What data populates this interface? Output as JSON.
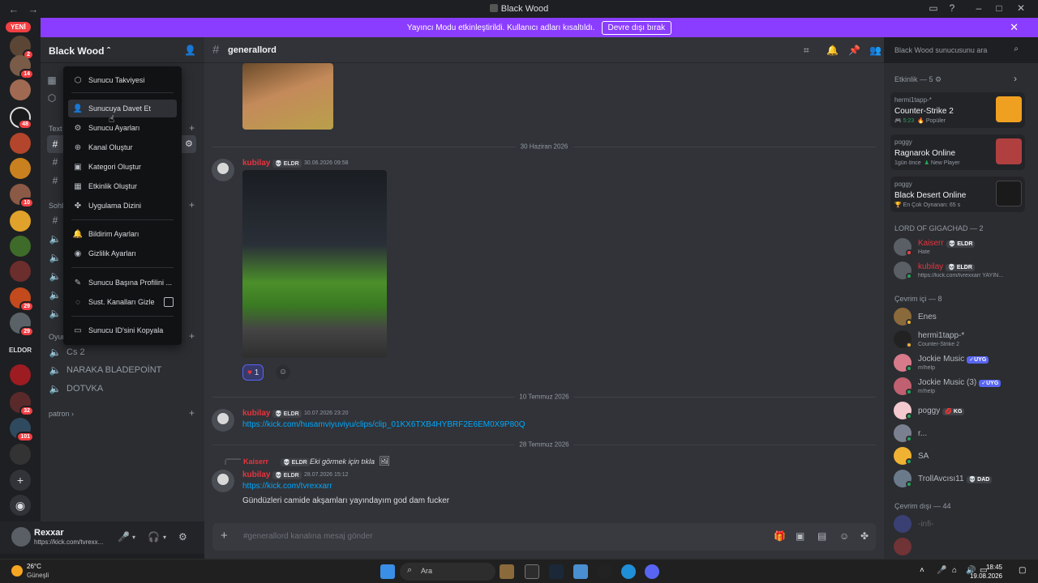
{
  "window": {
    "title": "Black Wood",
    "back_icon": "←",
    "forward_icon": "→"
  },
  "banner": {
    "text": "Yayıncı Modu etkinleştirildi. Kullanıcı adları kısaltıldı.",
    "button": "Devre dışı bırak"
  },
  "rail": {
    "yeni": "YENİ",
    "badges": [
      "2",
      "14",
      "48",
      "10",
      "29",
      "29",
      "32",
      "101"
    ],
    "eldor": "ELDOR"
  },
  "sidebar": {
    "server_name": "Black Wood",
    "categories": [
      "Text",
      "Sohb",
      "Oyun",
      "patron"
    ],
    "channels": [
      "Cs 2",
      "NARAKA BLADEPOİNT",
      "DOTVKA"
    ]
  },
  "menu": {
    "items": [
      "Sunucu Takviyesi",
      "Sunucuya Davet Et",
      "Sunucu Ayarları",
      "Kanal Oluştur",
      "Kategori Oluştur",
      "Etkinlik Oluştur",
      "Uygulama Dizini",
      "Bildirim Ayarları",
      "Gizlilik Ayarları",
      "Sunucu Başına Profilini ...",
      "Sust. Kanalları Gizle",
      "Sunucu ID'sini Kopyala"
    ]
  },
  "chat": {
    "channel": "generallord",
    "dividers": [
      "30 Haziran 2026",
      "10 Temmuz 2026",
      "28 Temmuz 2026"
    ],
    "messages": [
      {
        "author": "kubilay",
        "tag": "ELDR",
        "time": "30.06.2026 09:58"
      },
      {
        "author": "kubilay",
        "tag": "ELDR",
        "time": "10.07.2026 23:20",
        "link": "https://kick.com/husamviyuviyu/clips/clip_01KX6TXB4HYBRF2E6EM0X9P80Q"
      },
      {
        "author": "kubilay",
        "tag": "ELDR",
        "time": "28.07.2026 15:12",
        "link": "https://kick.com/tvrexxarr",
        "text": "Gündüzleri camide akşamları yayındayım god dam fucker"
      }
    ],
    "reply": {
      "author": "Kaiserr",
      "tag": "ELDR",
      "text": "Eki görmek için tıkla"
    },
    "reaction_count": "1",
    "composer_placeholder": "#generallord kanalına mesaj gönder"
  },
  "search": {
    "placeholder": "Black Wood sunucusunu ara"
  },
  "members": {
    "activity_header": "Etkinlik — 5",
    "activities": [
      {
        "user": "hermi1tapp-*",
        "game": "Counter-Strike 2",
        "time": "5:23",
        "status": "Popüler"
      },
      {
        "user": "poggy",
        "game": "Ragnarok Online",
        "time": "1gün önce",
        "status": "New Player"
      },
      {
        "user": "poggy",
        "game": "Black Desert Online",
        "status": "En Çok Oynanan: 65 s"
      }
    ],
    "lord_header": "LORD OF GIGACHAD — 2",
    "lords": [
      {
        "name": "Kaiserr",
        "tag": "ELDR",
        "sub": "Hate"
      },
      {
        "name": "kubilay",
        "tag": "ELDR",
        "sub": "https://kick.com/tvrexxarr YAYIN..."
      }
    ],
    "online_header": "Çevrim içi — 8",
    "online": [
      {
        "name": "Enes"
      },
      {
        "name": "hermi1tapp-*",
        "sub": "Counter-Strike 2"
      },
      {
        "name": "Jockie Music",
        "badge": "✓UYG",
        "sub": "m!help"
      },
      {
        "name": "Jockie Music (3)",
        "badge": "✓UYG",
        "sub": "m!help"
      },
      {
        "name": "poggy",
        "badge": "KG"
      },
      {
        "name": "r..."
      },
      {
        "name": "SA"
      },
      {
        "name": "TrollAvcısı11",
        "badge": "DAD"
      }
    ],
    "offline_header": "Çevrim dışı — 44",
    "offline_first": "-infi-"
  },
  "user": {
    "name": "Rexxar",
    "status": "https://kick.com/tvrexx..."
  },
  "taskbar": {
    "temp": "26°C",
    "cond": "Güneşli",
    "search": "Ara",
    "time": "18:45",
    "date": "19.08.2026"
  }
}
